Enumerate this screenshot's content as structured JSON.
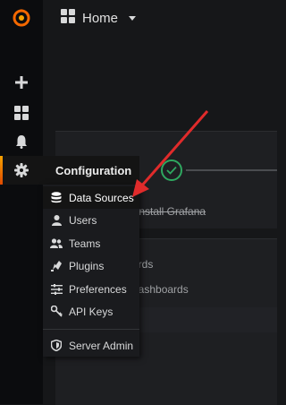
{
  "topbar": {
    "title": "Home"
  },
  "sidebar": {
    "icons": [
      "grafana-logo",
      "plus-icon",
      "dashboards-icon",
      "bell-icon",
      "gear-icon"
    ]
  },
  "config_menu": {
    "header": "Configuration",
    "items": [
      {
        "label": "Data Sources",
        "icon": "database-icon",
        "active": true
      },
      {
        "label": "Users",
        "icon": "user-icon"
      },
      {
        "label": "Teams",
        "icon": "users-icon"
      },
      {
        "label": "Plugins",
        "icon": "plug-icon"
      },
      {
        "label": "Preferences",
        "icon": "sliders-icon"
      },
      {
        "label": "API Keys",
        "icon": "key-icon"
      }
    ],
    "server_admin": {
      "label": "Server Admin",
      "icon": "shield-icon"
    }
  },
  "background": {
    "install_text": "Install Grafana",
    "dashboards_text": "ards",
    "dashboards_text2": "dashboards"
  },
  "colors": {
    "accent": "#f46800",
    "success": "#2fa860",
    "annotation_arrow": "#e02b2b"
  }
}
